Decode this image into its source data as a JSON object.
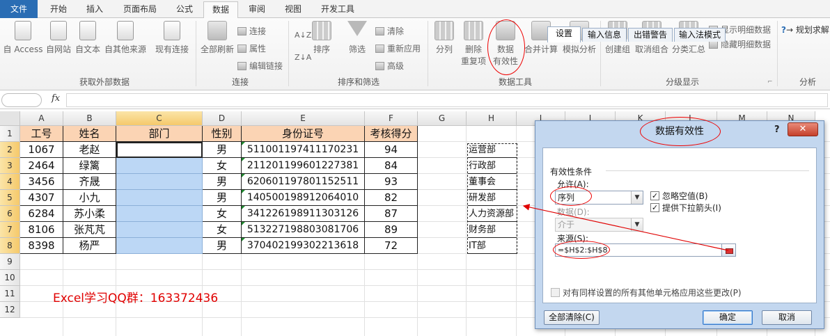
{
  "ribbon": {
    "tabs": [
      "文件",
      "开始",
      "插入",
      "页面布局",
      "公式",
      "数据",
      "审阅",
      "视图",
      "开发工具"
    ],
    "active_tab": "数据",
    "groups": {
      "external": {
        "label": "获取外部数据",
        "buttons": [
          "自 Access",
          "自网站",
          "自文本",
          "自其他来源",
          "现有连接"
        ]
      },
      "connections": {
        "label": "连接",
        "refresh_all": "全部刷新",
        "small": [
          "连接",
          "属性",
          "编辑链接"
        ]
      },
      "sort_filter": {
        "label": "排序和筛选",
        "sort": "排序",
        "filter": "筛选",
        "small": [
          "清除",
          "重新应用",
          "高级"
        ]
      },
      "data_tools": {
        "label": "数据工具",
        "split": "分列",
        "remove_dup": [
          "删除",
          "重复项"
        ],
        "validation": [
          "数据",
          "有效性"
        ],
        "consolidate": "合并计算",
        "whatif": "模拟分析"
      },
      "outline": {
        "label": "分级显示",
        "group": "创建组",
        "ungroup": "取消组合",
        "subtotal": "分类汇总",
        "small": [
          "显示明细数据",
          "隐藏明细数据"
        ]
      },
      "analysis": {
        "label": "分析",
        "solver": "规划求解"
      }
    }
  },
  "formula_bar": {
    "fx": "fx"
  },
  "sheet": {
    "columns": [
      "A",
      "B",
      "C",
      "D",
      "E",
      "F",
      "G",
      "H",
      "I",
      "J",
      "K",
      "L",
      "M",
      "N"
    ],
    "rows": [
      "1",
      "2",
      "3",
      "4",
      "5",
      "6",
      "7",
      "8",
      "9",
      "10",
      "11",
      "12"
    ],
    "headers": [
      "工号",
      "姓名",
      "部门",
      "性别",
      "身份证号",
      "考核得分"
    ],
    "records": [
      [
        "1067",
        "老赵",
        "",
        "男",
        "511001197411170231",
        "94"
      ],
      [
        "2464",
        "绿篱",
        "",
        "女",
        "211201199601227381",
        "84"
      ],
      [
        "3456",
        "齐晟",
        "",
        "男",
        "620601197801152511",
        "93"
      ],
      [
        "4307",
        "小九",
        "",
        "男",
        "140500198912064010",
        "82"
      ],
      [
        "6284",
        "苏小柔",
        "",
        "女",
        "341226198911303126",
        "87"
      ],
      [
        "8106",
        "张芃芃",
        "",
        "女",
        "513227198803081706",
        "89"
      ],
      [
        "8398",
        "杨严",
        "",
        "男",
        "370402199302213618",
        "72"
      ]
    ],
    "departments": [
      "运营部",
      "行政部",
      "董事会",
      "研发部",
      "人力资源部",
      "财务部",
      "IT部"
    ],
    "note": "Excel学习QQ群：163372436"
  },
  "dialog": {
    "title": "数据有效性",
    "help": "?",
    "close": "✕",
    "tabs": [
      "设置",
      "输入信息",
      "出错警告",
      "输入法模式"
    ],
    "criteria_label": "有效性条件",
    "allow_label": "允许(A):",
    "allow_value": "序列",
    "ignore_blank": "忽略空值(B)",
    "dropdown": "提供下拉箭头(I)",
    "check_mark": "✓",
    "data_label": "数据(D):",
    "data_value": "介于",
    "source_label": "来源(S):",
    "source_value": "=$H$2:$H$8",
    "apply_all": "对有同样设置的所有其他单元格应用这些更改(P)",
    "clear_all": "全部清除(C)",
    "ok": "确定",
    "cancel": "取消"
  },
  "colors": {
    "header_fill": "#fbd4b4",
    "selection_fill": "#bcd7f5",
    "annotation": "#e00000",
    "file_tab": "#2a6db4"
  }
}
